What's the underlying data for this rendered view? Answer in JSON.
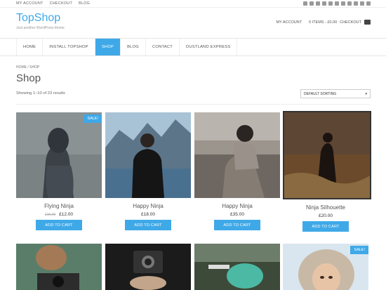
{
  "topbar": {
    "links": [
      "MY ACCOUNT",
      "CHECKOUT",
      "BLOG"
    ],
    "social_icons": [
      "mail-icon",
      "rss-icon",
      "facebook-icon",
      "twitter-icon",
      "google-plus-icon",
      "youtube-icon",
      "linkedin-icon",
      "instagram-icon",
      "pinterest-icon",
      "tumblr-icon",
      "flickr-icon"
    ]
  },
  "header": {
    "logo": "TopShop",
    "tagline": "Just another WordPress theme",
    "my_account": "MY ACCOUNT",
    "cart_summary": "0 ITEMS - £0.00",
    "checkout": "CHECKOUT"
  },
  "nav": {
    "items": [
      "HOME",
      "INSTALL TOPSHOP",
      "SHOP",
      "BLOG",
      "CONTACT",
      "DUSTLAND EXPRESS"
    ],
    "active": "SHOP"
  },
  "breadcrumb": "HOME / SHOP",
  "page_title": "Shop",
  "results_text": "Showing 1–10 of 23 results",
  "sort": {
    "selected": "DEFAULT SORTING"
  },
  "colors": {
    "accent": "#3fa9e8"
  },
  "sale_label": "SALE!",
  "add_to_cart_label": "ADD TO CART",
  "products": [
    {
      "name": "Flying Ninja",
      "old_price": "£15.00",
      "price": "£12.00",
      "sale": true
    },
    {
      "name": "Happy Ninja",
      "price": "£18.00",
      "sale": false
    },
    {
      "name": "Happy Ninja",
      "price": "£35.00",
      "sale": false
    },
    {
      "name": "Ninja Silhouette",
      "price": "£20.00",
      "sale": false
    }
  ],
  "second_row_sale": true
}
